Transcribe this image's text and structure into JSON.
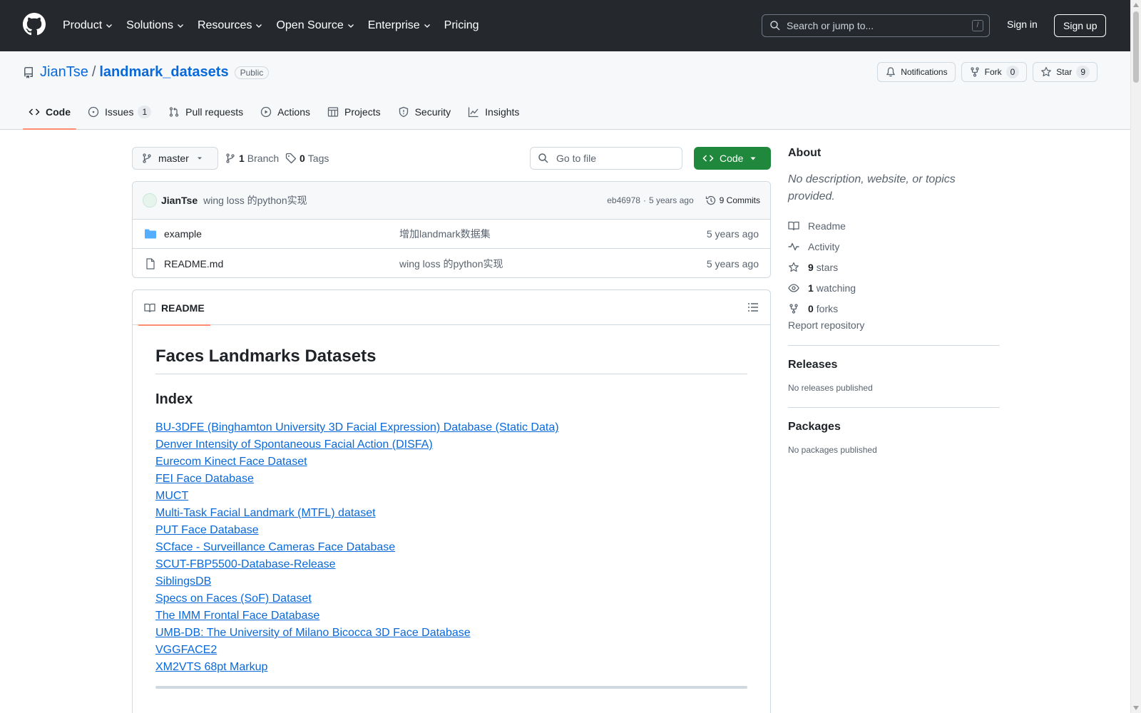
{
  "header": {
    "nav": [
      "Product",
      "Solutions",
      "Resources",
      "Open Source",
      "Enterprise",
      "Pricing"
    ],
    "search_placeholder": "Search or jump to...",
    "search_shortcut": "/",
    "signin": "Sign in",
    "signup": "Sign up"
  },
  "repo": {
    "owner": "JianTse",
    "separator": "/",
    "name": "landmark_datasets",
    "visibility": "Public",
    "notifications": "Notifications",
    "fork_label": "Fork",
    "fork_count": "0",
    "star_label": "Star",
    "star_count": "9"
  },
  "tabs": [
    {
      "label": "Code",
      "active": true
    },
    {
      "label": "Issues",
      "count": "1"
    },
    {
      "label": "Pull requests"
    },
    {
      "label": "Actions"
    },
    {
      "label": "Projects"
    },
    {
      "label": "Security"
    },
    {
      "label": "Insights"
    }
  ],
  "toolbar": {
    "branch": "master",
    "branch_count": "1",
    "branch_label": "Branch",
    "tag_count": "0",
    "tag_label": "Tags",
    "goto_placeholder": "Go to file",
    "code_button": "Code"
  },
  "commit": {
    "author": "JianTse",
    "message": "wing loss 的python实现",
    "hash": "eb46978",
    "dot": "·",
    "age": "5 years ago",
    "commits": "9 Commits"
  },
  "files": [
    {
      "name": "example",
      "type": "folder",
      "message": "增加landmark数据集",
      "date": "5 years ago"
    },
    {
      "name": "README.md",
      "type": "file",
      "message": "wing loss 的python实现",
      "date": "5 years ago"
    }
  ],
  "readme": {
    "tab": "README",
    "h1": "Faces Landmarks Datasets",
    "h2": "Index",
    "links": [
      "BU-3DFE (Binghamton University 3D Facial Expression) Database (Static Data)",
      "Denver Intensity of Spontaneous Facial Action (DISFA)",
      "Eurecom Kinect Face Dataset",
      "FEI Face Database",
      "MUCT",
      "Multi-Task Facial Landmark (MTFL) dataset",
      "PUT Face Database",
      "SCface - Surveillance Cameras Face Database",
      "SCUT-FBP5500-Database-Release",
      "SiblingsDB",
      "Specs on Faces (SoF) Dataset",
      "The IMM Frontal Face Database",
      "UMB-DB: The University of Milano Bicocca 3D Face Database",
      "VGGFACE2",
      "XM2VTS 68pt Markup"
    ]
  },
  "about": {
    "title": "About",
    "description": "No description, website, or topics provided.",
    "readme": "Readme",
    "activity": "Activity",
    "stars_count": "9",
    "stars_label": "stars",
    "watching_count": "1",
    "watching_label": "watching",
    "forks_count": "0",
    "forks_label": "forks",
    "report": "Report repository",
    "releases_title": "Releases",
    "releases_text": "No releases published",
    "packages_title": "Packages",
    "packages_text": "No packages published"
  }
}
